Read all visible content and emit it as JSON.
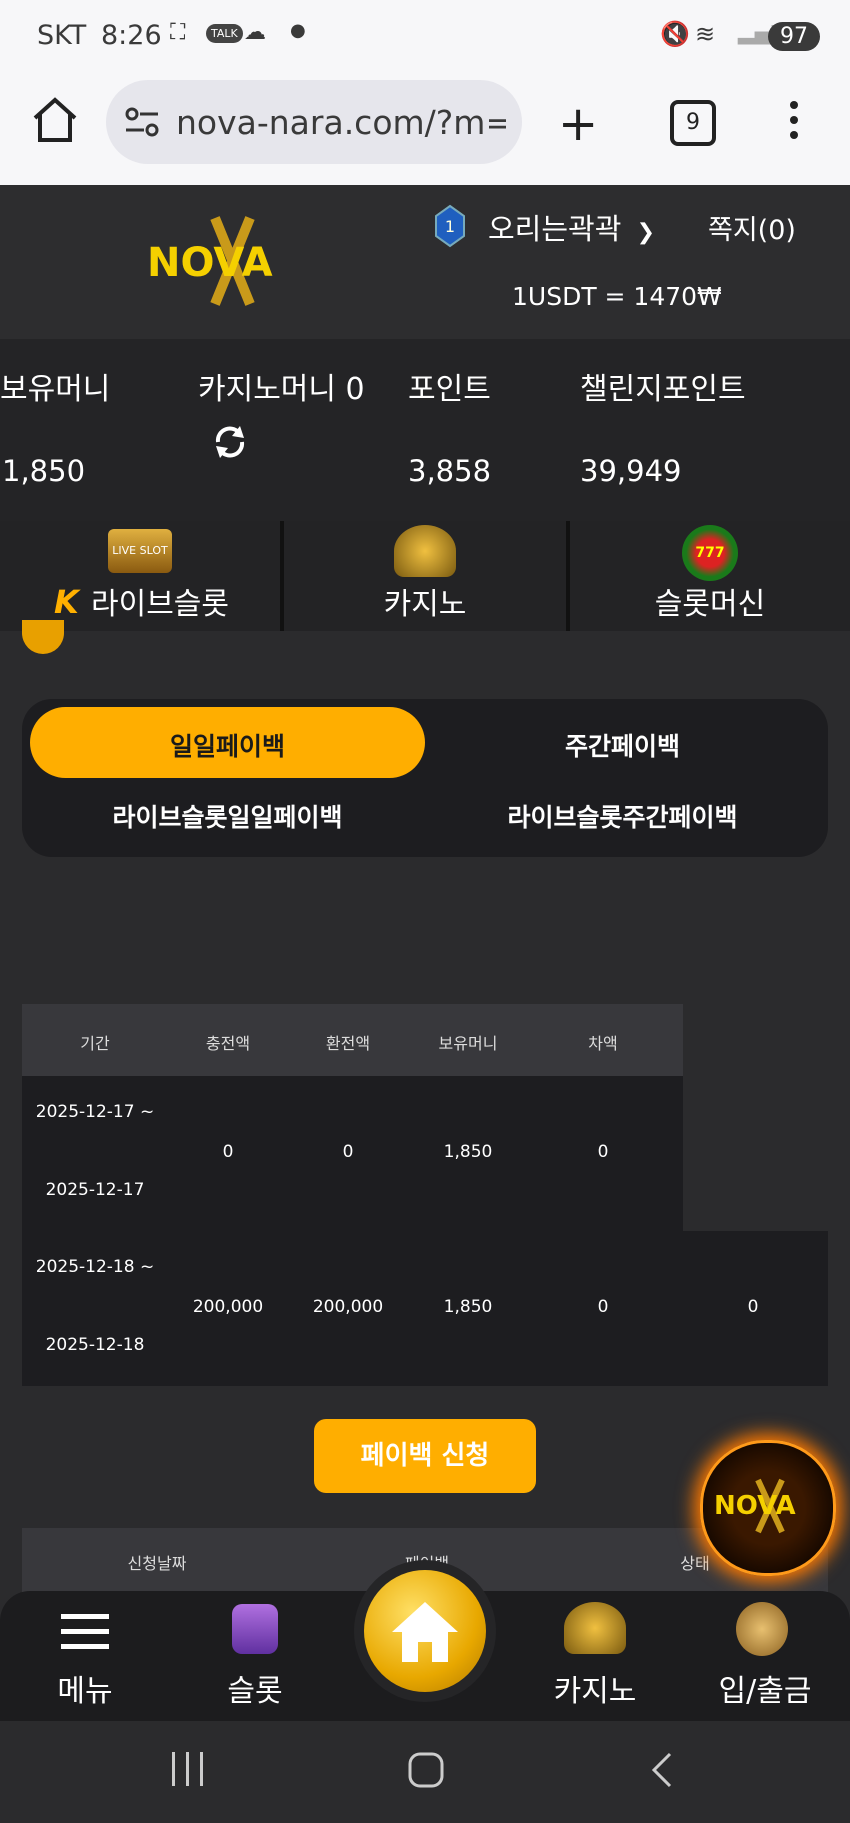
{
  "status_bar": {
    "carrier": "SKT",
    "time": "8:26",
    "battery": "97"
  },
  "browser": {
    "url": "nova-nara.com/?m=",
    "tab_count": "9"
  },
  "header": {
    "logo_text": "NOVA",
    "user_level": "1",
    "username": "오리는곽곽",
    "messages": "쪽지(0)",
    "rate": "1USDT = 1470₩"
  },
  "stats": {
    "balance_label": "보유머니",
    "balance_value": "1,850",
    "casino_label": "카지노머니 0",
    "point_label": "포인트",
    "point_value": "3,858",
    "challenge_label": "챌린지포인트",
    "challenge_value": "39,949"
  },
  "game_tabs": [
    {
      "label": "라이브슬롯"
    },
    {
      "label": "카지노"
    },
    {
      "label": "슬롯머신"
    }
  ],
  "payback_tabs": [
    {
      "label": "일일페이백",
      "active": true
    },
    {
      "label": "주간페이백"
    },
    {
      "label": "라이브슬롯일일페이백"
    },
    {
      "label": "라이브슬롯주간페이백"
    }
  ],
  "table": {
    "headers": [
      "기간",
      "충전액",
      "환전액",
      "보유머니",
      "차액"
    ],
    "rows": [
      {
        "from": "2025-12-17 ~",
        "to": "2025-12-17",
        "deposit": "0",
        "withdraw": "0",
        "balance": "1,850",
        "diff": "0",
        "extra": ""
      },
      {
        "from": "2025-12-18 ~",
        "to": "2025-12-18",
        "deposit": "200,000",
        "withdraw": "200,000",
        "balance": "1,850",
        "diff": "0",
        "extra": "0"
      }
    ]
  },
  "apply_button": "페이백 신청",
  "apply_table_headers": [
    "신청날짜",
    "페이백",
    "상태"
  ],
  "bottom_nav": [
    {
      "label": "메뉴"
    },
    {
      "label": "슬롯"
    },
    {
      "label": "카지노"
    },
    {
      "label": "입/출금"
    }
  ],
  "colors": {
    "accent": "#ffae00",
    "bg": "#2b2b2d"
  }
}
